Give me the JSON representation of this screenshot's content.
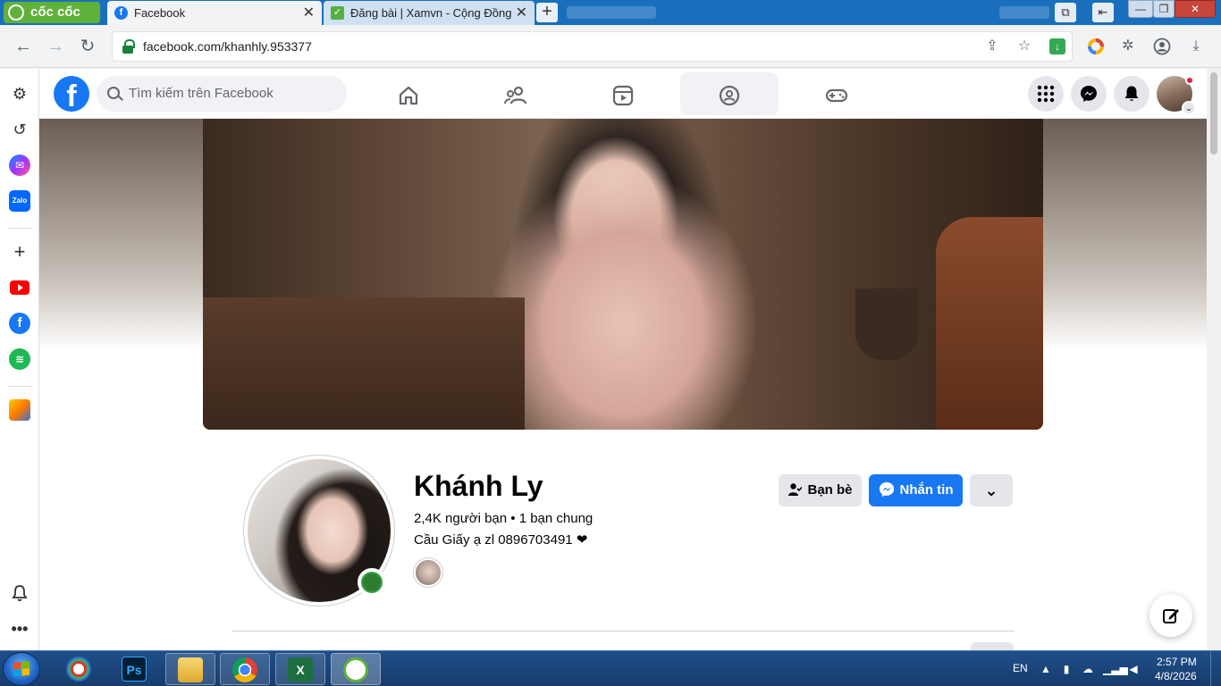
{
  "browser": {
    "brand_label": "cốc cốc",
    "tabs": [
      {
        "title": "Facebook",
        "close": "✕",
        "favicon": "f"
      },
      {
        "title": "Đăng bài | Xamvn - Cộng Đồng",
        "close": "✕",
        "favicon": "✓"
      }
    ],
    "new_tab": "+",
    "url": "facebook.com/khanhly.953377"
  },
  "facebook": {
    "search_placeholder": "Tìm kiếm trên Facebook",
    "logo_letter": "f"
  },
  "profile": {
    "name": "Khánh Ly",
    "friends_line": "2,4K người bạn • 1 bạn chung",
    "bio": "Cầu Giấy ạ zl 0896703491 ❤",
    "friends_button": "Bạn bè",
    "message_button": "Nhắn tin",
    "more_button": "⌄"
  },
  "taskbar": {
    "language": "EN",
    "time": "2:57 PM",
    "date": "4/8/2026",
    "apps": [
      "Ps"
    ]
  },
  "colors": {
    "fb_blue": "#1877f2",
    "coccoc_green": "#5fb13a",
    "online_green": "#31a24c"
  }
}
